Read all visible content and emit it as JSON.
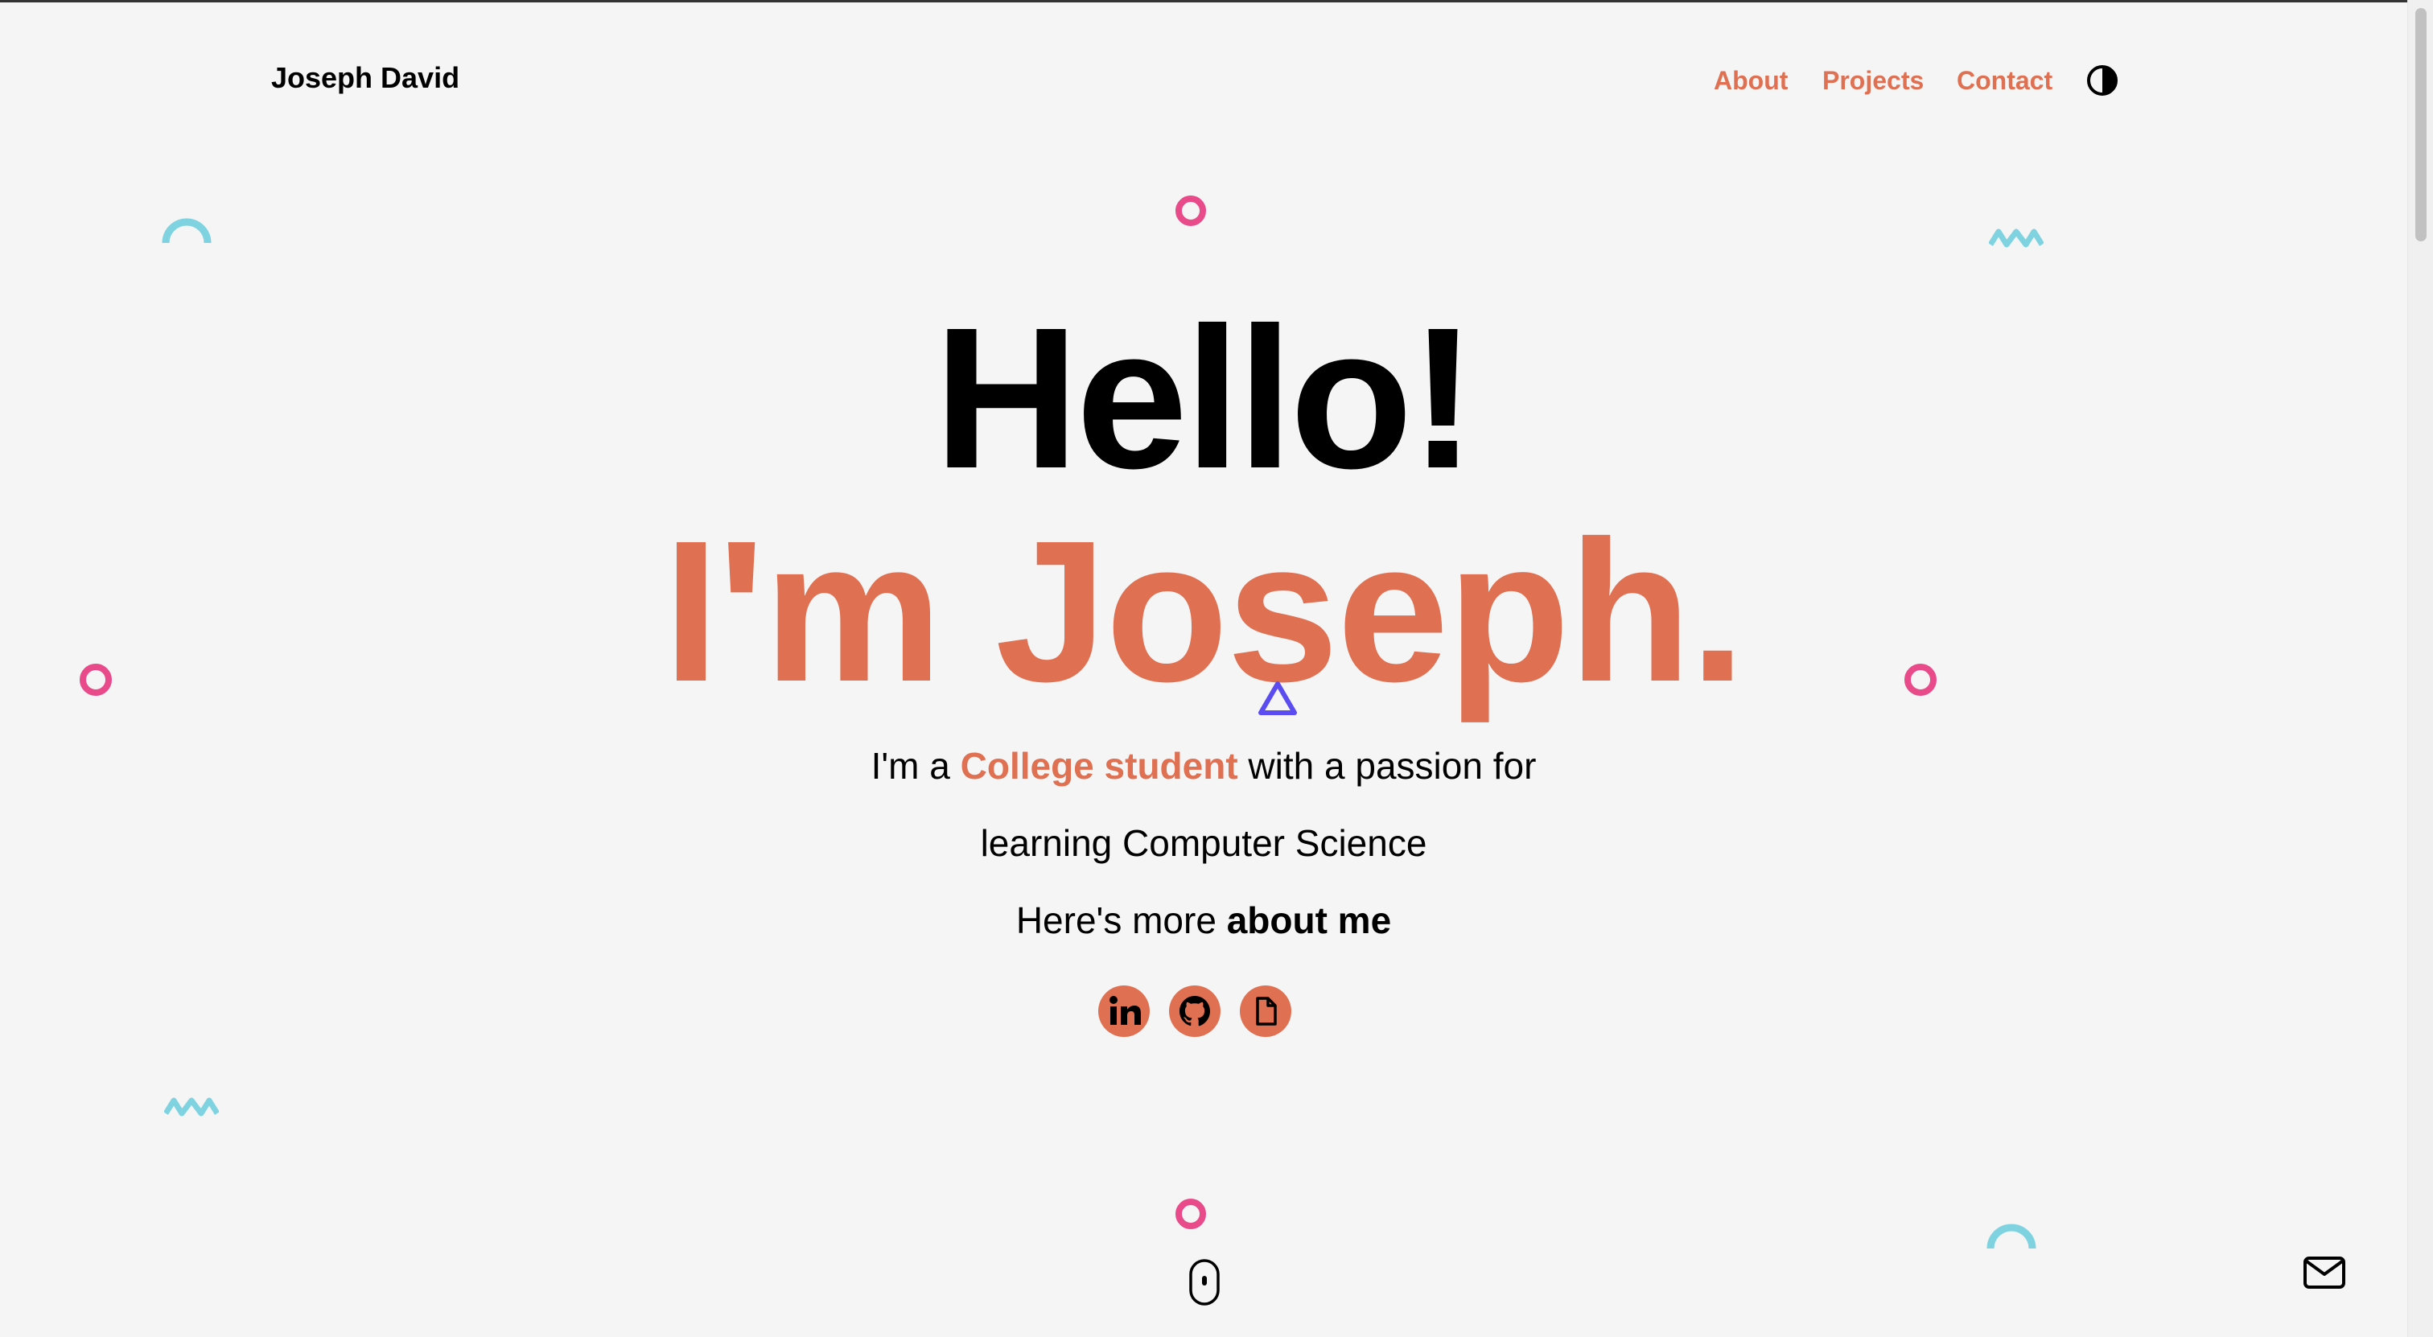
{
  "header": {
    "brand": "Joseph David",
    "nav": [
      {
        "label": "About"
      },
      {
        "label": "Projects"
      },
      {
        "label": "Contact"
      }
    ],
    "theme_toggle_icon": "contrast-icon"
  },
  "hero": {
    "greeting": "Hello!",
    "name": "I'm Joseph.",
    "intro_prefix": "I'm a ",
    "intro_accent": "College student",
    "intro_suffix": " with a passion for",
    "intro_line2": "learning Computer Science",
    "more_prefix": "Here's more ",
    "more_link": "about me"
  },
  "social": [
    {
      "name": "linkedin-icon"
    },
    {
      "name": "github-icon"
    },
    {
      "name": "resume-icon"
    }
  ],
  "colors": {
    "accent": "#e07052",
    "ring": "#e84a8a",
    "wave": "#7fd3e0",
    "triangle": "#5a4cf0",
    "background": "#f5f5f5"
  }
}
